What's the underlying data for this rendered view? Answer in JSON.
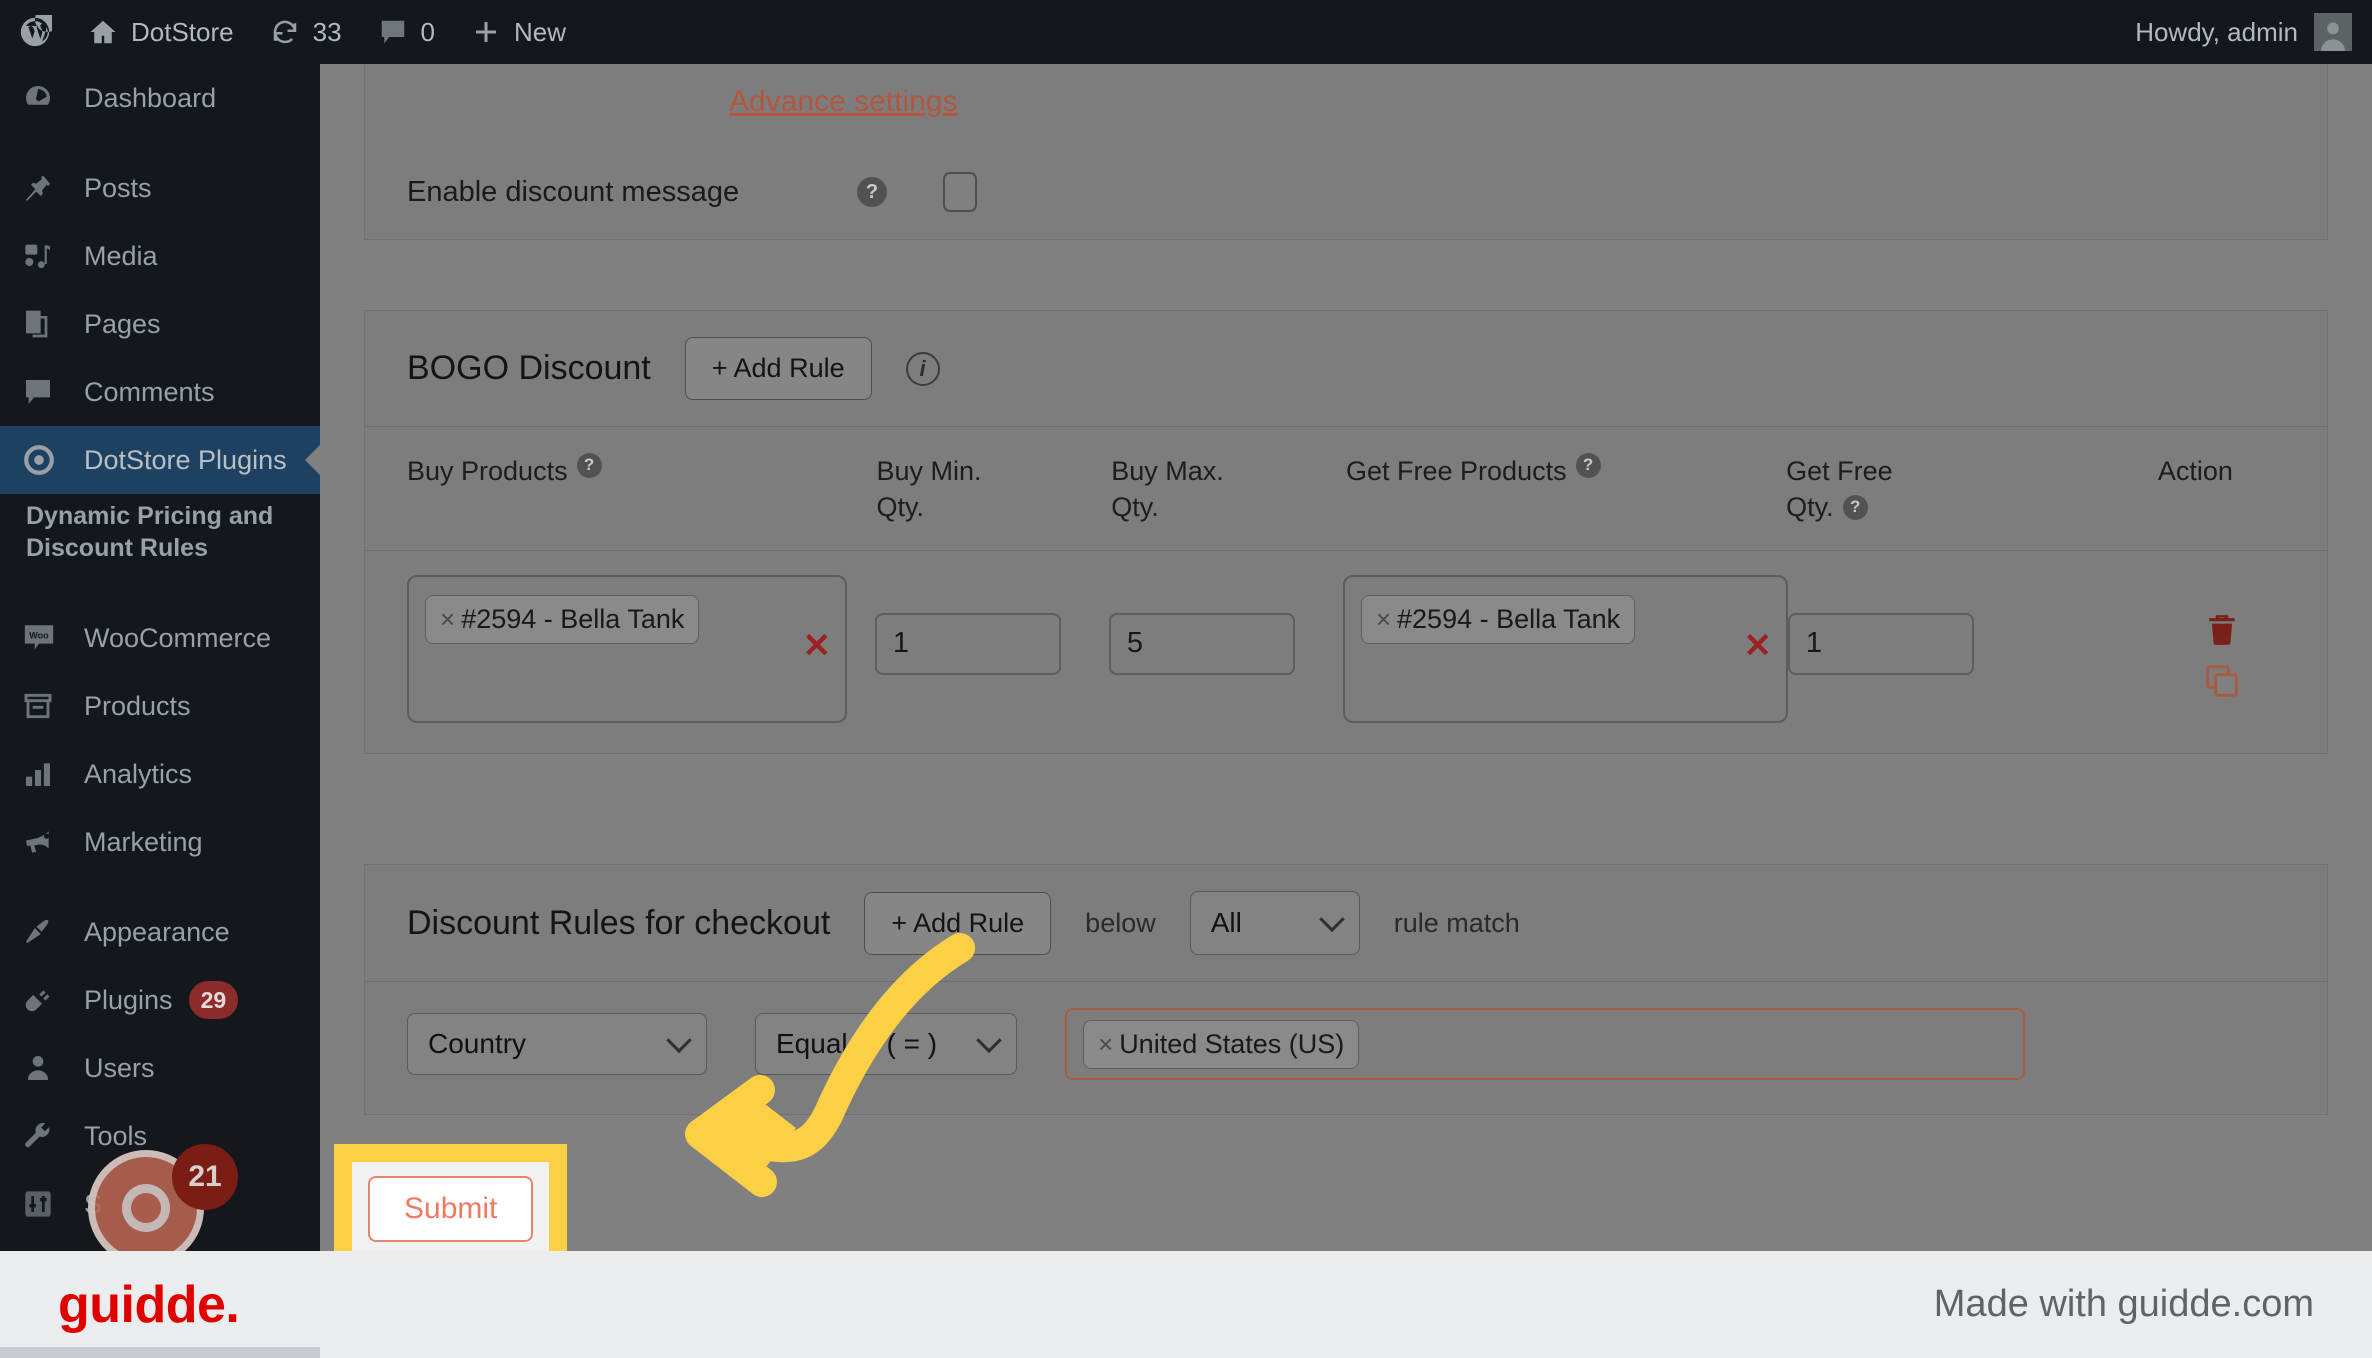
{
  "adminbar": {
    "wp_icon": "wordpress-logo-icon",
    "items": [
      {
        "icon": "home-icon",
        "label": "DotStore"
      },
      {
        "icon": "updates-icon",
        "label": "33"
      },
      {
        "icon": "comment-bubble-icon",
        "label": "0"
      },
      {
        "icon": "plus-icon",
        "label": "New"
      }
    ],
    "greeting": "Howdy, admin",
    "avatar_icon": "user-avatar-icon"
  },
  "sidebar": {
    "items": [
      {
        "icon": "dashboard-icon",
        "label": "Dashboard",
        "active": false,
        "badge": ""
      },
      {
        "icon": "pin-icon",
        "label": "Posts",
        "active": false,
        "badge": ""
      },
      {
        "icon": "media-icon",
        "label": "Media",
        "active": false,
        "badge": ""
      },
      {
        "icon": "pages-icon",
        "label": "Pages",
        "active": false,
        "badge": ""
      },
      {
        "icon": "comments-icon",
        "label": "Comments",
        "active": false,
        "badge": ""
      },
      {
        "icon": "dotstore-target-icon",
        "label": "DotStore Plugins",
        "active": true,
        "badge": ""
      },
      {
        "icon": "woo-icon",
        "label": "WooCommerce",
        "active": false,
        "badge": ""
      },
      {
        "icon": "products-box-icon",
        "label": "Products",
        "active": false,
        "badge": ""
      },
      {
        "icon": "analytics-bars-icon",
        "label": "Analytics",
        "active": false,
        "badge": ""
      },
      {
        "icon": "marketing-megaphone-icon",
        "label": "Marketing",
        "active": false,
        "badge": ""
      },
      {
        "icon": "appearance-brush-icon",
        "label": "Appearance",
        "active": false,
        "badge": ""
      },
      {
        "icon": "plugins-plug-icon",
        "label": "Plugins",
        "active": false,
        "badge": "29"
      },
      {
        "icon": "users-icon",
        "label": "Users",
        "active": false,
        "badge": ""
      },
      {
        "icon": "tools-wrench-icon",
        "label": "Tools",
        "active": false,
        "badge": ""
      },
      {
        "icon": "settings-sliders-icon",
        "label": "S",
        "active": false,
        "badge": ""
      }
    ],
    "submenu_label": "Dynamic Pricing and Discount Rules"
  },
  "top_panel": {
    "advance_settings_link": "Advance settings",
    "enable_discount_message_label": "Enable discount message",
    "enable_discount_message_checked": false,
    "help_icon": "question-mark-icon"
  },
  "bogo": {
    "title": "BOGO Discount",
    "add_rule_label": "+ Add Rule",
    "info_icon": "info-circle-icon",
    "columns": [
      {
        "label": "Buy Products",
        "help": true
      },
      {
        "label": "Buy Min.\nQty.",
        "help": false
      },
      {
        "label": "Buy Max.\nQty.",
        "help": false
      },
      {
        "label": "Get Free Products",
        "help": true
      },
      {
        "label": "Get Free\nQty.",
        "help": true
      },
      {
        "label": "Action",
        "help": false
      }
    ],
    "col_buy_products": "Buy Products",
    "col_buy_min_l1": "Buy Min.",
    "col_buy_min_l2": "Qty.",
    "col_buy_max_l1": "Buy Max.",
    "col_buy_max_l2": "Qty.",
    "col_get_free_products": "Get Free Products",
    "col_get_free_l1": "Get Free",
    "col_get_free_l2": "Qty.",
    "col_action": "Action",
    "row": {
      "buy_product_tag": "#2594 - Bella Tank",
      "buy_min_qty": "1",
      "buy_max_qty": "5",
      "free_product_tag": "#2594 - Bella Tank",
      "free_qty": "1",
      "tag_remove_icon": "tag-remove-x-icon",
      "clear_icon": "clear-all-x-icon",
      "delete_icon": "trash-can-icon",
      "duplicate_icon": "copy-duplicate-icon"
    }
  },
  "checkout_rules": {
    "title": "Discount Rules for checkout",
    "add_rule_label": "+ Add Rule",
    "below_label": "below",
    "match_select_value": "All",
    "match_suffix_label": "rule match",
    "rule": {
      "field_value": "Country",
      "operator_value": "Equal to ( = )",
      "value_tag": "United States (US)",
      "tag_remove_icon": "tag-remove-x-icon"
    }
  },
  "submit": {
    "label": "Submit"
  },
  "annotation": {
    "arrow_icon": "curved-left-arrow-icon",
    "highlight_color": "#fcd045"
  },
  "recording": {
    "badge_count": "21"
  },
  "footer": {
    "logo_text": "guidde.",
    "right_text": "Made with guidde.com"
  }
}
